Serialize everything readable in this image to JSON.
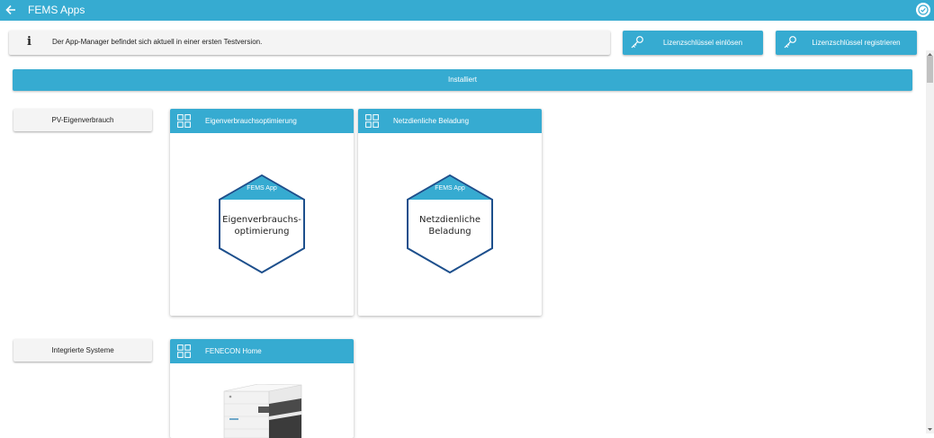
{
  "header": {
    "title": "FEMS Apps",
    "back_icon": "arrow-left-icon",
    "status_icon": "check-circle-icon"
  },
  "info": {
    "icon": "info-icon",
    "glyph": "i",
    "text": "Der App-Manager befindet sich aktuell in einer ersten Testversion."
  },
  "actions": {
    "redeem_label": "Lizenzschlüssel einlösen",
    "register_label": "Lizenzschlüssel registrieren",
    "key_icon": "key-icon"
  },
  "installed": {
    "label": "Installiert"
  },
  "categories": [
    {
      "label": "PV-Eigenverbrauch",
      "apps": [
        {
          "title": "Eigenverbrauchsoptimierung",
          "badge": "FEMS App",
          "logo_line1": "Eigenverbrauchs-",
          "logo_line2": "optimierung"
        },
        {
          "title": "Netzdienliche Beladung",
          "badge": "FEMS App",
          "logo_line1": "Netzdienliche",
          "logo_line2": "Beladung"
        }
      ]
    },
    {
      "label": "Integrierte Systeme",
      "apps": [
        {
          "title": "FENECON Home"
        }
      ]
    }
  ],
  "colors": {
    "accent": "#36abd1",
    "hex_border": "#1d4f8c",
    "button_bg": "#f4f4f4"
  }
}
